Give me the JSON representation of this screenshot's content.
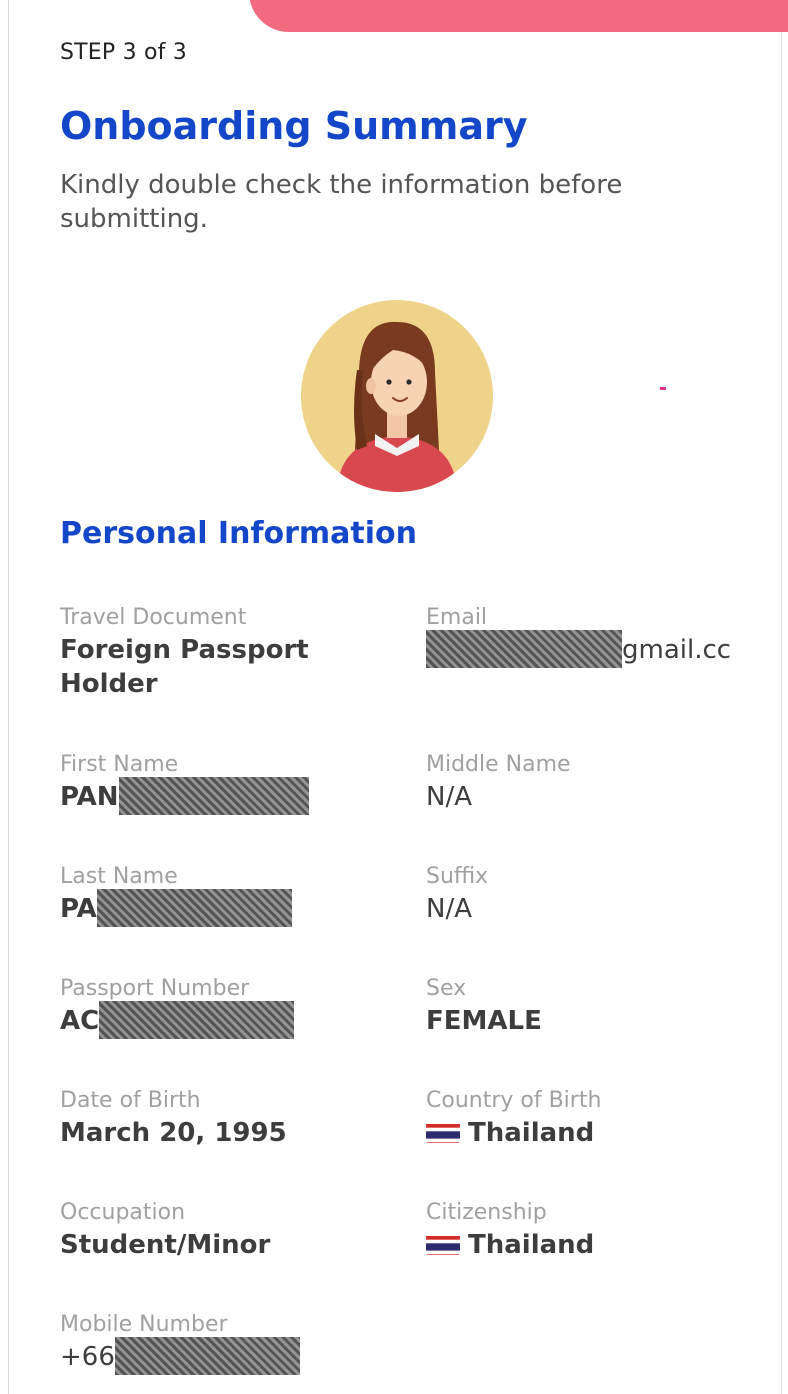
{
  "header": {
    "step": "STEP 3 of 3",
    "title": "Onboarding Summary",
    "subtitle": "Kindly double check the information before submitting."
  },
  "avatar": {
    "icon": "female-avatar-icon"
  },
  "section": {
    "title": "Personal Information"
  },
  "fields": {
    "travel_document": {
      "label": "Travel Document",
      "value": "Foreign Passport Holder"
    },
    "email": {
      "label": "Email",
      "value_prefix": "",
      "value_suffix": "gmail.cc"
    },
    "first_name": {
      "label": "First Name",
      "value_prefix": "PAN"
    },
    "middle_name": {
      "label": "Middle Name",
      "value": "N/A"
    },
    "last_name": {
      "label": "Last Name",
      "value_prefix": "PA"
    },
    "suffix": {
      "label": "Suffix",
      "value": "N/A"
    },
    "passport_number": {
      "label": "Passport Number",
      "value_prefix": "AC"
    },
    "sex": {
      "label": "Sex",
      "value": "FEMALE"
    },
    "date_of_birth": {
      "label": "Date of Birth",
      "value": "March 20, 1995"
    },
    "country_of_birth": {
      "label": "Country of Birth",
      "value": "Thailand",
      "flag": "thailand-flag-icon"
    },
    "occupation": {
      "label": "Occupation",
      "value": "Student/Minor"
    },
    "citizenship": {
      "label": "Citizenship",
      "value": "Thailand",
      "flag": "thailand-flag-icon"
    },
    "mobile_number": {
      "label": "Mobile Number",
      "value_prefix": "+66"
    }
  },
  "colors": {
    "accent": "#1346c9",
    "banner": "#f26a7e",
    "avatar_bg": "#f0d38a"
  }
}
